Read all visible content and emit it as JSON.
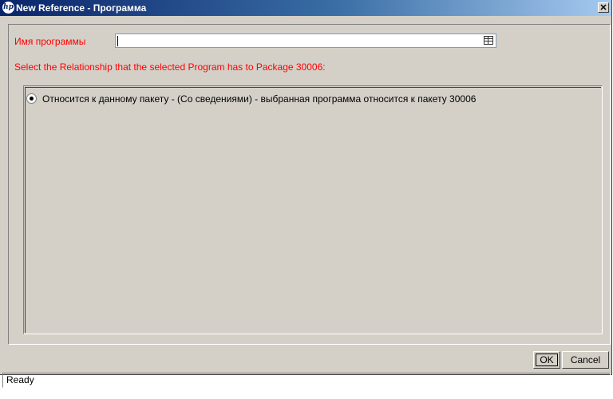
{
  "window": {
    "title": "New Reference - Программа",
    "close_label": "✕"
  },
  "form": {
    "program_label": "Имя программы",
    "program_value": "",
    "instruction": "Select the Relationship that the selected Program has to Package 30006:"
  },
  "relationships": [
    {
      "label": "Относится к данному пакету - (Со сведениями) - выбранная программа относится к пакету 30006",
      "selected": true
    }
  ],
  "buttons": {
    "ok": "OK",
    "cancel": "Cancel"
  },
  "status": {
    "text": "Ready"
  }
}
